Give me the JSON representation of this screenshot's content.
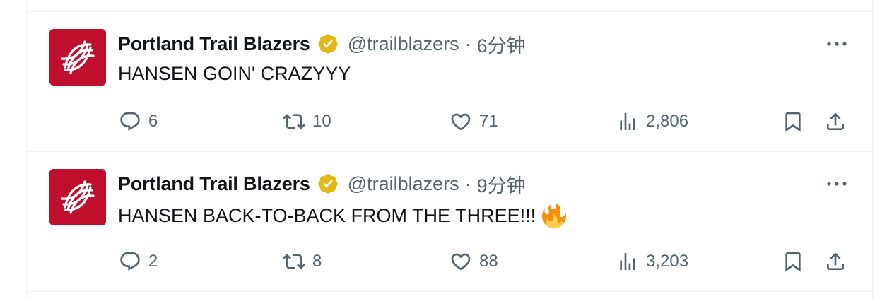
{
  "tweets": [
    {
      "author_name": "Portland Trail Blazers",
      "handle": "@trailblazers",
      "separator": "·",
      "time": "6分钟",
      "text": "HANSEN GOIN' CRAZYYY",
      "emoji": "",
      "replies": "6",
      "retweets": "10",
      "likes": "71",
      "views": "2,806"
    },
    {
      "author_name": "Portland Trail Blazers",
      "handle": "@trailblazers",
      "separator": "·",
      "time": "9分钟",
      "text": "HANSEN BACK-TO-BACK FROM THE THREE!!!",
      "emoji": "fire-emoji",
      "replies": "2",
      "retweets": "8",
      "likes": "88",
      "views": "3,203"
    }
  ],
  "colors": {
    "text_primary": "#0f1419",
    "text_secondary": "#536471",
    "verified_gold": "#e2b719",
    "avatar_red": "#c8102e",
    "divider": "#eff3f4"
  },
  "icons": {
    "reply": "reply-icon",
    "retweet": "retweet-icon",
    "like": "like-icon",
    "views": "views-icon",
    "bookmark": "bookmark-icon",
    "share": "share-icon",
    "more": "more-icon",
    "verified": "verified-badge-icon"
  }
}
